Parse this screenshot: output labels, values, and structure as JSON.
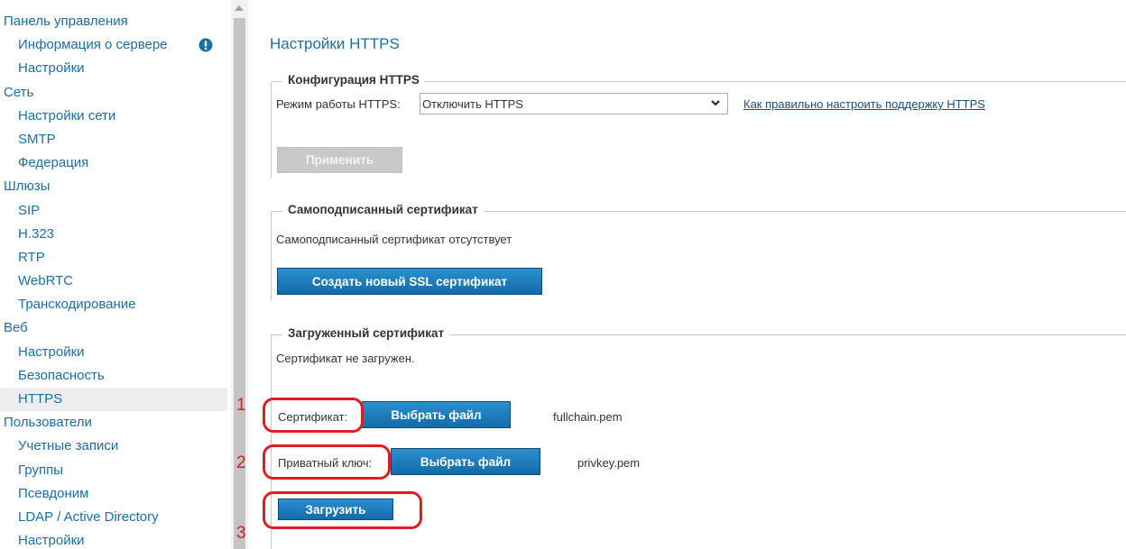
{
  "sidebar": {
    "groups": [
      {
        "label": "Панель управления",
        "items": [
          "Информация о сервере",
          "Настройки"
        ]
      },
      {
        "label": "Сеть",
        "items": [
          "Настройки сети",
          "SMTP",
          "Федерация"
        ]
      },
      {
        "label": "Шлюзы",
        "items": [
          "SIP",
          "H.323",
          "RTP",
          "WebRTC",
          "Транскодирование"
        ]
      },
      {
        "label": "Веб",
        "items": [
          "Настройки",
          "Безопасность",
          "HTTPS"
        ]
      },
      {
        "label": "Пользователи",
        "items": [
          "Учетные записи",
          "Группы",
          "Псевдоним",
          "LDAP / Active Directory",
          "Настройки"
        ]
      }
    ],
    "active_item": "HTTPS"
  },
  "steps": [
    "1",
    "2",
    "3"
  ],
  "page_title": "Настройки HTTPS",
  "https_config": {
    "legend": "Конфигурация HTTPS",
    "mode_label": "Режим работы HTTPS:",
    "mode_value": "Отключить HTTPS",
    "help_link": "Как правильно настроить поддержку HTTPS",
    "apply_button": "Применить"
  },
  "self_signed": {
    "legend": "Самоподписанный сертификат",
    "status": "Самоподписанный сертификат отсутствует",
    "create_button": "Создать новый SSL сертификат"
  },
  "uploaded": {
    "legend": "Загруженный сертификат",
    "status": "Сертификат не загружен.",
    "cert_label": "Сертификат:",
    "cert_button": "Выбрать файл",
    "cert_file": "fullchain.pem",
    "key_label": "Приватный ключ:",
    "key_button": "Выбрать файл",
    "key_file": "privkey.pem",
    "upload_button": "Загрузить"
  },
  "colors": {
    "link": "#1a6fa3",
    "button": "#136ba9",
    "annotation": "#e01b22"
  }
}
